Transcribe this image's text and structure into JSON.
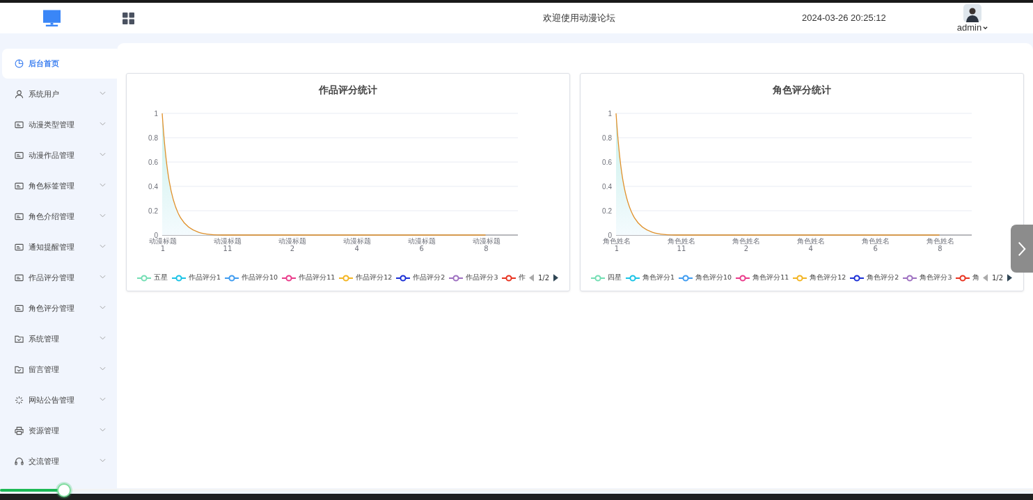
{
  "header": {
    "title": "欢迎使用动漫论坛",
    "datetime": "2024-03-26 20:25:12",
    "user": "admin"
  },
  "sidebar": {
    "items": [
      {
        "label": "后台首页",
        "kind": "pie",
        "selected": true
      },
      {
        "label": "系统用户",
        "kind": "user",
        "selected": false
      },
      {
        "label": "动漫类型管理",
        "kind": "card",
        "selected": false
      },
      {
        "label": "动漫作品管理",
        "kind": "card",
        "selected": false
      },
      {
        "label": "角色标签管理",
        "kind": "card",
        "selected": false
      },
      {
        "label": "角色介绍管理",
        "kind": "card",
        "selected": false
      },
      {
        "label": "通知提醒管理",
        "kind": "card",
        "selected": false
      },
      {
        "label": "作品评分管理",
        "kind": "card",
        "selected": false
      },
      {
        "label": "角色评分管理",
        "kind": "card",
        "selected": false
      },
      {
        "label": "系统管理",
        "kind": "folder",
        "selected": false
      },
      {
        "label": "留言管理",
        "kind": "folder",
        "selected": false
      },
      {
        "label": "网站公告管理",
        "kind": "spinner",
        "selected": false
      },
      {
        "label": "资源管理",
        "kind": "printer",
        "selected": false
      },
      {
        "label": "交流管理",
        "kind": "headset",
        "selected": false
      }
    ]
  },
  "charts": [
    {
      "legend": [
        {
          "label": "五星",
          "color": "#73deb3"
        },
        {
          "label": "作品评分1",
          "color": "#19c3e6"
        },
        {
          "label": "作品评分10",
          "color": "#3e9bf0"
        },
        {
          "label": "作品评分11",
          "color": "#ea3a8a"
        },
        {
          "label": "作品评分12",
          "color": "#f3b421"
        },
        {
          "label": "作品评分2",
          "color": "#1a2fd6"
        },
        {
          "label": "作品评分3",
          "color": "#9d6fc0"
        },
        {
          "label": "作",
          "color": "#e8321f"
        }
      ],
      "legend_page": "1/2",
      "chart_data": {
        "type": "area",
        "title": "作品评分统计",
        "categories": [
          "动漫标题1",
          "动漫标题11",
          "动漫标题2",
          "动漫标题4",
          "动漫标题6",
          "动漫标题8"
        ],
        "ylim": [
          0,
          1
        ],
        "yticks": [
          0,
          0.2,
          0.4,
          0.6,
          0.8,
          1
        ],
        "grid": true,
        "series": [
          {
            "color": "#e0902a",
            "values": [
              1,
              0,
              0,
              0,
              0,
              0
            ]
          }
        ]
      }
    },
    {
      "legend": [
        {
          "label": "四星",
          "color": "#73deb3"
        },
        {
          "label": "角色评分1",
          "color": "#19c3e6"
        },
        {
          "label": "角色评分10",
          "color": "#3e9bf0"
        },
        {
          "label": "角色评分11",
          "color": "#ea3a8a"
        },
        {
          "label": "角色评分12",
          "color": "#f3b421"
        },
        {
          "label": "角色评分2",
          "color": "#1a2fd6"
        },
        {
          "label": "角色评分3",
          "color": "#9d6fc0"
        },
        {
          "label": "角",
          "color": "#e8321f"
        }
      ],
      "legend_page": "1/2",
      "chart_data": {
        "type": "area",
        "title": "角色评分统计",
        "categories": [
          "角色姓名1",
          "角色姓名11",
          "角色姓名2",
          "角色姓名4",
          "角色姓名6",
          "角色姓名8"
        ],
        "ylim": [
          0,
          1
        ],
        "yticks": [
          0,
          0.2,
          0.4,
          0.6,
          0.8,
          1
        ],
        "grid": true,
        "series": [
          {
            "color": "#e0902a",
            "values": [
              1,
              0,
              0,
              0,
              0,
              0
            ]
          }
        ]
      }
    }
  ],
  "progress": {
    "level": 0.062
  }
}
